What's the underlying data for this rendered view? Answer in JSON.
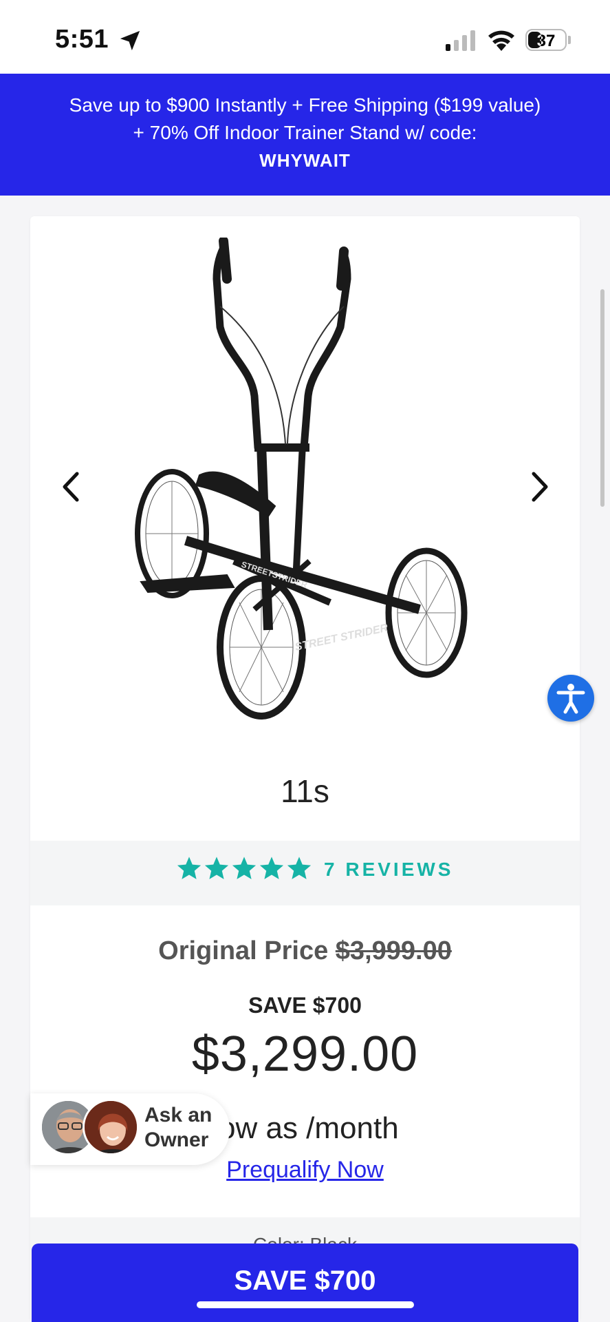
{
  "status_bar": {
    "time": "5:51",
    "battery": "37",
    "battery_level": 0.37
  },
  "promo": {
    "text": "Save up to $900 Instantly + Free Shipping ($199 value) + 70% Off Indoor Trainer Stand w/ code:",
    "code": "WHYWAIT"
  },
  "product": {
    "model": "11s",
    "rating": 5,
    "reviews_label": "7 REVIEWS",
    "original_price_label": "Original Price",
    "original_price": "$3,999.00",
    "save_label": "SAVE $700",
    "price": "$3,299.00",
    "monthly_text": "ow as  /month",
    "prequalify_label": "Prequalify Now",
    "color_label": "Color: Black"
  },
  "ask_owner": {
    "label_line1": "Ask an",
    "label_line2": "Owner"
  },
  "cta": {
    "label": "SAVE $700"
  },
  "colors": {
    "brand_blue": "#2626e8",
    "star_teal": "#16b3a6",
    "accessibility_blue": "#1f6fe5"
  },
  "icons": {
    "prev": "chevron-left-icon",
    "next": "chevron-right-icon",
    "accessibility": "accessibility-icon",
    "location": "location-arrow-icon",
    "signal": "cellular-signal-icon",
    "wifi": "wifi-icon"
  }
}
